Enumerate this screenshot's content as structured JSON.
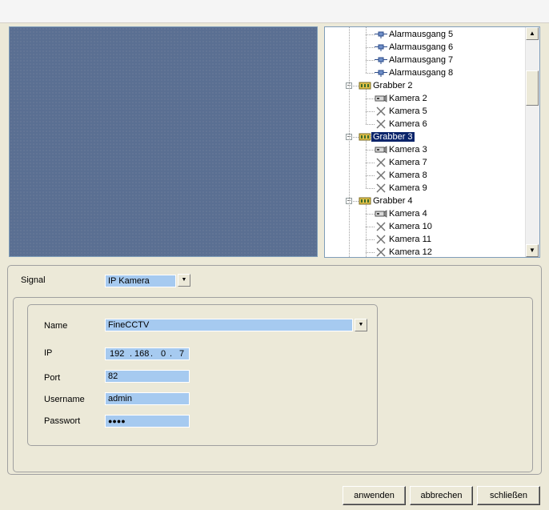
{
  "tree": {
    "nodes": [
      {
        "label": "Alarmausgang 5",
        "type": "output",
        "level": 2
      },
      {
        "label": "Alarmausgang 6",
        "type": "output",
        "level": 2
      },
      {
        "label": "Alarmausgang 7",
        "type": "output",
        "level": 2
      },
      {
        "label": "Alarmausgang 8",
        "type": "output",
        "level": 2
      },
      {
        "label": "Grabber 2",
        "type": "grabber",
        "level": 1,
        "expanded": true
      },
      {
        "label": "Kamera 2",
        "type": "camera",
        "level": 2
      },
      {
        "label": "Kamera 5",
        "type": "disabled",
        "level": 2
      },
      {
        "label": "Kamera 6",
        "type": "disabled",
        "level": 2
      },
      {
        "label": "Grabber 3",
        "type": "grabber",
        "level": 1,
        "expanded": true,
        "selected": true
      },
      {
        "label": "Kamera 3",
        "type": "camera",
        "level": 2
      },
      {
        "label": "Kamera 7",
        "type": "disabled",
        "level": 2
      },
      {
        "label": "Kamera 8",
        "type": "disabled",
        "level": 2
      },
      {
        "label": "Kamera 9",
        "type": "disabled",
        "level": 2
      },
      {
        "label": "Grabber 4",
        "type": "grabber",
        "level": 1,
        "expanded": true
      },
      {
        "label": "Kamera 4",
        "type": "camera",
        "level": 2
      },
      {
        "label": "Kamera 10",
        "type": "disabled",
        "level": 2
      },
      {
        "label": "Kamera 11",
        "type": "disabled",
        "level": 2
      },
      {
        "label": "Kamera 12",
        "type": "disabled",
        "level": 2
      }
    ]
  },
  "signal": {
    "label": "Signal",
    "value": "IP Kamera"
  },
  "form": {
    "name_label": "Name",
    "name_value": "FineCCTV",
    "ip_label": "IP",
    "ip_octets": [
      "192",
      "168",
      "0",
      "7"
    ],
    "port_label": "Port",
    "port_value": "82",
    "username_label": "Username",
    "username_value": "admin",
    "password_label": "Passwort",
    "password_value": "●●●●"
  },
  "buttons": {
    "apply": "anwenden",
    "cancel": "abbrechen",
    "close": "schließen"
  },
  "colors": {
    "preview_bg": "#5a6f92",
    "field_bg": "#a6caf0",
    "selection": "#0a246a"
  },
  "icons": {
    "expander_minus": "−",
    "scroll_up": "▲",
    "scroll_down": "▼",
    "dropdown": "▼"
  }
}
